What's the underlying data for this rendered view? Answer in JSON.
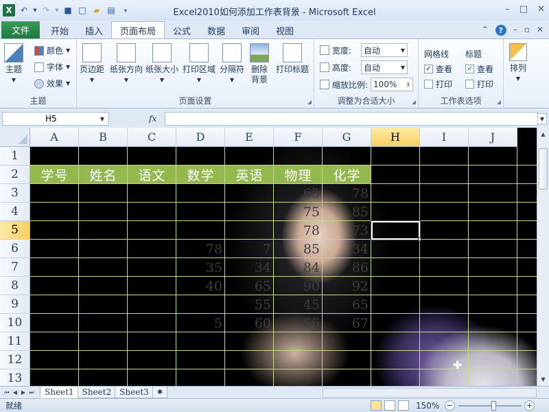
{
  "window": {
    "title": "Excel2010如何添加工作表背景 - Microsoft Excel",
    "controls": [
      "–",
      "□",
      "✕"
    ]
  },
  "ribbon_tabs": {
    "file": "文件",
    "tabs": [
      "开始",
      "插入",
      "页面布局",
      "公式",
      "数据",
      "审阅",
      "视图"
    ],
    "active": "页面布局"
  },
  "ribbon": {
    "theme": {
      "main": "主题",
      "colors": "颜色",
      "fonts": "字体",
      "effects": "效果",
      "group_label": "主题"
    },
    "page_setup": {
      "margins": "页边距",
      "orientation": "纸张方向",
      "size": "纸张大小",
      "print_area": "打印区域",
      "breaks": "分隔符",
      "background": "删除\n背景",
      "print_titles": "打印标题",
      "group_label": "页面设置"
    },
    "scale": {
      "width_label": "宽度:",
      "width_value": "自动",
      "height_label": "高度:",
      "height_value": "自动",
      "scale_label": "缩放比例:",
      "scale_value": "100%",
      "group_label": "调整为合适大小"
    },
    "sheet_options": {
      "gridlines": "网格线",
      "headings": "标题",
      "view": "查看",
      "print": "打印",
      "group_label": "工作表选项"
    },
    "arrange": {
      "label": "排列"
    }
  },
  "formula_bar": {
    "name_box": "H5",
    "fx": "fx",
    "content": ""
  },
  "grid": {
    "columns": [
      "A",
      "B",
      "C",
      "D",
      "E",
      "F",
      "G",
      "H",
      "I",
      "J"
    ],
    "rows": [
      "1",
      "2",
      "3",
      "4",
      "5",
      "6",
      "7",
      "8",
      "9",
      "10",
      "11",
      "12",
      "13"
    ],
    "selected_column": "H",
    "selected_row": "5",
    "header_row": [
      "学号",
      "姓名",
      "语文",
      "数学",
      "英语",
      "物理",
      "化学"
    ],
    "visible_values": [
      {
        "row": 3,
        "F": "65",
        "G": "78"
      },
      {
        "row": 4,
        "F": "75",
        "G": "85"
      },
      {
        "row": 5,
        "F": "78",
        "G": "73"
      },
      {
        "row": 6,
        "D": "78",
        "E": "7",
        "F": "85",
        "G": "34"
      },
      {
        "row": 7,
        "D": "35",
        "E": "34",
        "F": "84",
        "G": "86"
      },
      {
        "row": 8,
        "D": "40",
        "E": "65",
        "F": "90",
        "G": "92"
      },
      {
        "row": 9,
        "E": "55",
        "F": "45",
        "G": "65"
      },
      {
        "row": 10,
        "D": "5",
        "E": "60",
        "F": "66",
        "G": "67"
      }
    ]
  },
  "sheets": {
    "tabs": [
      "Sheet1",
      "Sheet2",
      "Sheet3"
    ],
    "active": "Sheet1"
  },
  "status": {
    "ready": "就绪",
    "zoom": "150%",
    "zoom_level_percent": 150
  }
}
